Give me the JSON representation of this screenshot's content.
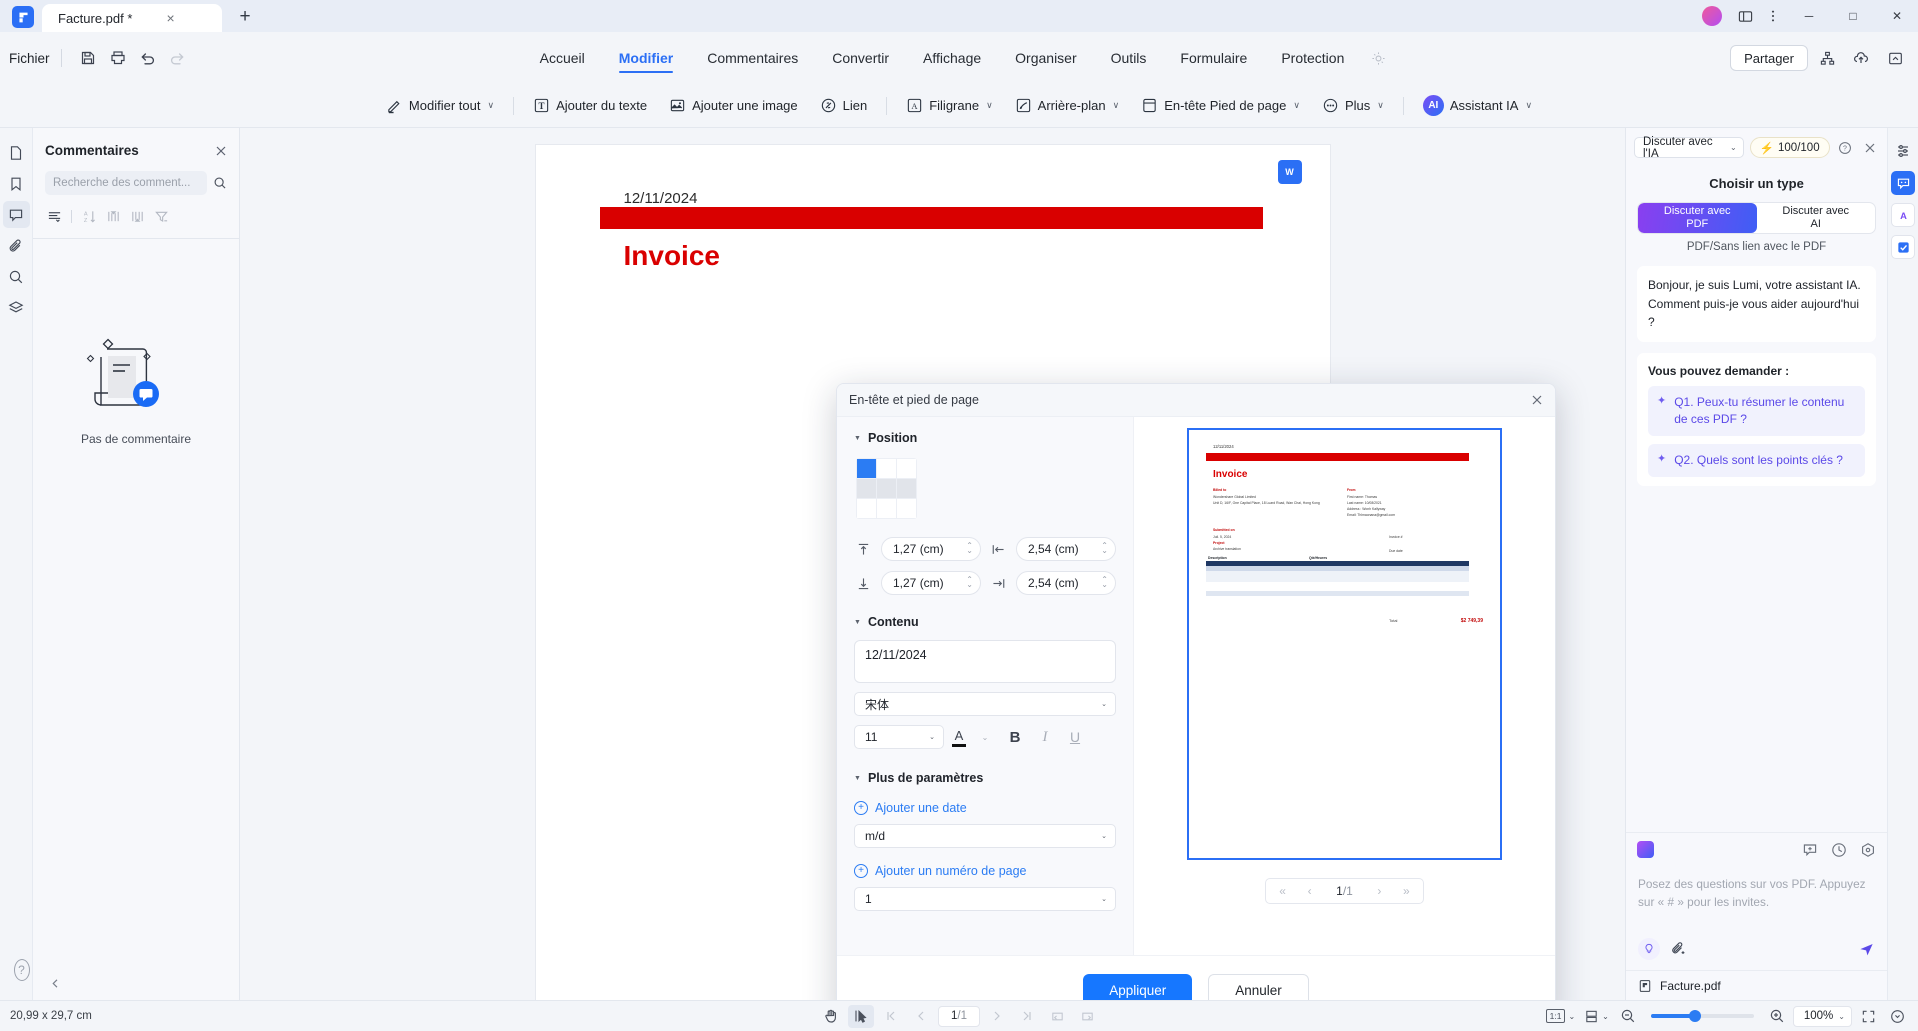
{
  "titlebar": {
    "tab_title": "Facture.pdf *",
    "close_tab": "×",
    "new_tab": "+",
    "minimize": "─",
    "maximize": "□",
    "close": "✕"
  },
  "menurow": {
    "file_menu": "Fichier",
    "tabs": [
      {
        "label": "Accueil",
        "active": false
      },
      {
        "label": "Modifier",
        "active": true
      },
      {
        "label": "Commentaires",
        "active": false
      },
      {
        "label": "Convertir",
        "active": false
      },
      {
        "label": "Affichage",
        "active": false
      },
      {
        "label": "Organiser",
        "active": false
      },
      {
        "label": "Outils",
        "active": false
      },
      {
        "label": "Formulaire",
        "active": false
      },
      {
        "label": "Protection",
        "active": false
      }
    ],
    "share_label": "Partager"
  },
  "ribbon": {
    "items": [
      {
        "label": "Modifier tout",
        "caret": "∨"
      },
      {
        "label": "Ajouter du texte",
        "caret": ""
      },
      {
        "label": "Ajouter une image",
        "caret": ""
      },
      {
        "label": "Lien",
        "caret": ""
      },
      {
        "label": "Filigrane",
        "caret": "∨"
      },
      {
        "label": "Arrière-plan",
        "caret": "∨"
      },
      {
        "label": "En-tête  Pied de page",
        "caret": "∨"
      },
      {
        "label": "Plus",
        "caret": "∨"
      },
      {
        "label": "Assistant IA",
        "caret": "∨"
      }
    ],
    "ai_badge": "AI"
  },
  "comments_panel": {
    "title": "Commentaires",
    "search_placeholder": "Recherche des comment...",
    "empty_text": "Pas de commentaire"
  },
  "document": {
    "date": "12/11/2024",
    "invoice_title": "Invoice",
    "wm_badge": "W"
  },
  "dialog": {
    "title": "En-tête et pied de page",
    "close": "✕",
    "position": {
      "label": "Position",
      "selected_cell": 0,
      "top_margin": "1,27 (cm)",
      "bottom_margin": "1,27 (cm)",
      "left_margin": "2,54 (cm)",
      "right_margin": "2,54 (cm)"
    },
    "content": {
      "label": "Contenu",
      "text_value": "12/11/2024",
      "font_family": "宋体",
      "font_size": "11",
      "bold": "B",
      "italic": "I",
      "underline": "U",
      "font_color_glyph": "A"
    },
    "more": {
      "label": "Plus de paramètres",
      "add_date_label": "Ajouter une date",
      "date_format": "m/d",
      "add_page_number_label": "Ajouter un numéro de page",
      "page_number_format": "1"
    },
    "preview": {
      "date": "12/11/2024",
      "invoice_title": "Invoice",
      "billed_to_label": "Billed to",
      "billed_to_lines": [
        "Wondershare Global Limited",
        "Unit D, 16/F, One Capital Place, 18 Luard Road, Wan Chai, Hong Kong"
      ],
      "from_label": "From",
      "from_lines": [
        "First name: Thomas",
        "Last name: 10/08/2021",
        "Address : Wonh Kallyway",
        "Email: Thlmaonana@gmail.com"
      ],
      "submitted_label": "Submitted on",
      "submitted_lines": [
        "Juil. 5, 2024",
        "Project",
        "Archive translation"
      ],
      "invoice_num_label": "Invoice #",
      "due_label": "Due date",
      "table_headers": [
        "Description",
        "Qté/Heures"
      ],
      "total_label": "Total",
      "total_value": "$2 749,39"
    },
    "pager": {
      "first": "«",
      "prev": "‹",
      "current": "1",
      "separator": "/",
      "total": "1",
      "next": "›",
      "last": "»"
    },
    "apply_label": "Appliquer",
    "cancel_label": "Annuler"
  },
  "ai_panel": {
    "mode_select": "Discuter avec l'IA",
    "credits": "100/100",
    "credits_icon": "⚡",
    "help": "?",
    "close": "✕",
    "choose_type_title": "Choisir un type",
    "type_options": [
      {
        "line1": "Discuter avec",
        "line2": "PDF",
        "selected": true
      },
      {
        "line1": "Discuter avec",
        "line2": "AI",
        "selected": false
      }
    ],
    "subnote": "PDF/Sans lien avec le PDF",
    "greeting": "Bonjour, je suis Lumi, votre assistant IA. Comment puis-je vous aider aujourd'hui ?",
    "suggestions_label": "Vous pouvez demander :",
    "suggestions": [
      "Q1. Peux-tu résumer le contenu de ces PDF ?",
      "Q2. Quels sont les points clés ?"
    ],
    "input_placeholder": "Posez des questions sur vos PDF. Appuyez sur « # » pour les invites.",
    "attached_file": "Facture.pdf"
  },
  "statusbar": {
    "dimensions": "20,99 x 29,7 cm",
    "page_current": "1",
    "page_separator": "/",
    "page_total": "1",
    "fit_label": "1:1",
    "zoom_level": "100%"
  },
  "colors": {
    "accent": "#2b6ff5",
    "primary_button": "#1677ff",
    "invoice_red": "#d90000",
    "ai_purple": "#6f5df0",
    "panel_bg": "#f3f5f9"
  }
}
